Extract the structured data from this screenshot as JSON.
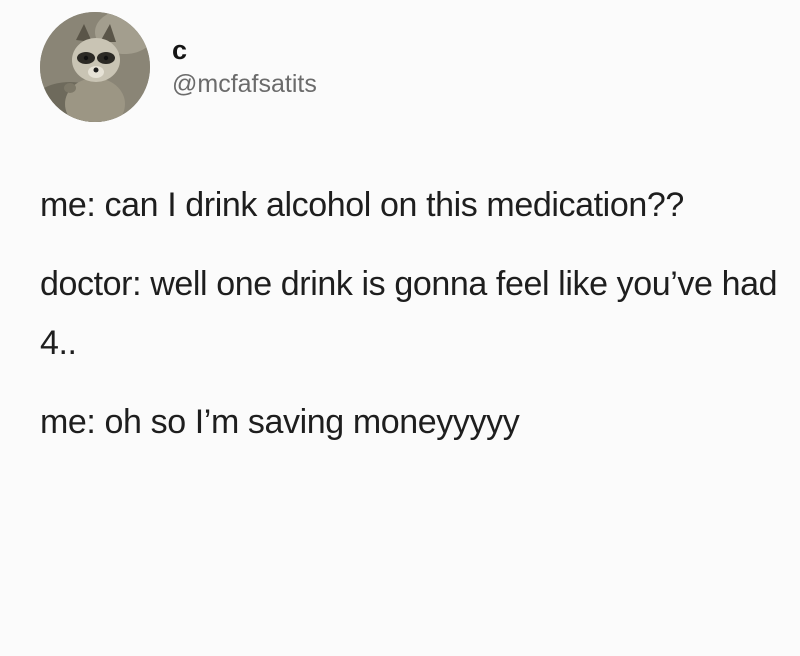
{
  "user": {
    "display_name": "c",
    "handle": "@mcfafsatits",
    "avatar_icon": "raccoon-avatar-icon"
  },
  "tweet": {
    "lines": [
      "me: can I drink alcohol on this medication??",
      "doctor: well one drink is gonna feel like you’ve had 4..",
      "me: oh so I’m saving moneyyyyy"
    ]
  },
  "colors": {
    "background": "#fbfbfb",
    "text": "#1e1e1e",
    "handle": "#6b6b6b"
  }
}
